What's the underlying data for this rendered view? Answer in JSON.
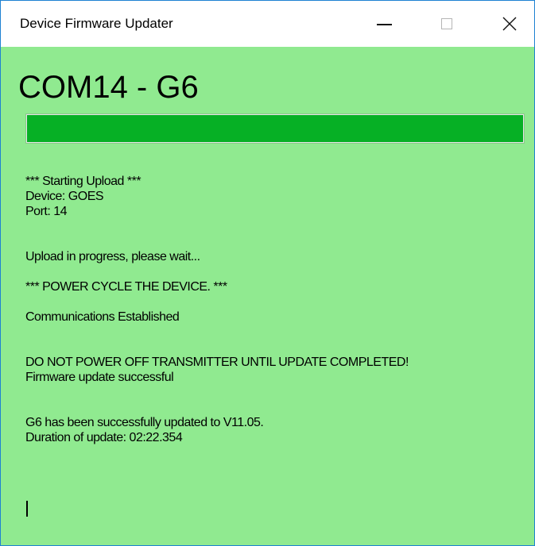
{
  "window": {
    "title": "Device Firmware Updater"
  },
  "controls": {
    "minimize_icon": "minimize-icon",
    "maximize_icon": "maximize-icon",
    "close_icon": "close-icon",
    "close_glyph": "✕"
  },
  "main": {
    "heading": "COM14 - G6",
    "progress_fraction": 1.0,
    "progress_color": "#06b025",
    "background_color": "#90ea90"
  },
  "log": {
    "lines": [
      "*** Starting Upload ***",
      "Device: GOES",
      "Port: 14",
      "",
      "",
      "Upload in progress, please wait...",
      "",
      "*** POWER CYCLE THE DEVICE. ***",
      "",
      "Communications Established",
      "",
      "",
      "DO NOT POWER OFF TRANSMITTER UNTIL UPDATE COMPLETED!",
      "Firmware update successful",
      "",
      "",
      "G6 has been successfully updated to V11.05.",
      "Duration of update: 02:22.354"
    ]
  }
}
